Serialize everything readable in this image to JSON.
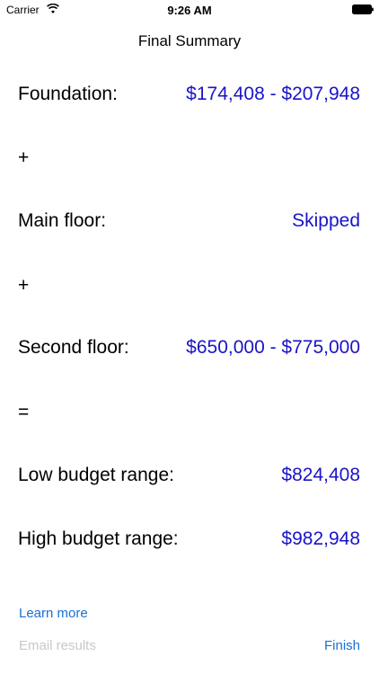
{
  "status_bar": {
    "carrier": "Carrier",
    "time": "9:26 AM"
  },
  "nav": {
    "title": "Final Summary"
  },
  "summary": {
    "foundation": {
      "label": "Foundation:",
      "value": "$174,408 - $207,948"
    },
    "plus_1": "+",
    "main_floor": {
      "label": "Main floor:",
      "value": "Skipped"
    },
    "plus_2": "+",
    "second_floor": {
      "label": "Second floor:",
      "value": "$650,000 - $775,000"
    },
    "equals": "=",
    "low_budget": {
      "label": "Low budget range:",
      "value": "$824,408"
    },
    "high_budget": {
      "label": "High budget range:",
      "value": "$982,948"
    }
  },
  "actions": {
    "learn_more": "Learn more",
    "email_results": "Email results",
    "finish": "Finish"
  },
  "colors": {
    "value_blue": "#1a14c8",
    "link_blue": "#1a6fd6",
    "disabled_gray": "#c8c8cc"
  }
}
